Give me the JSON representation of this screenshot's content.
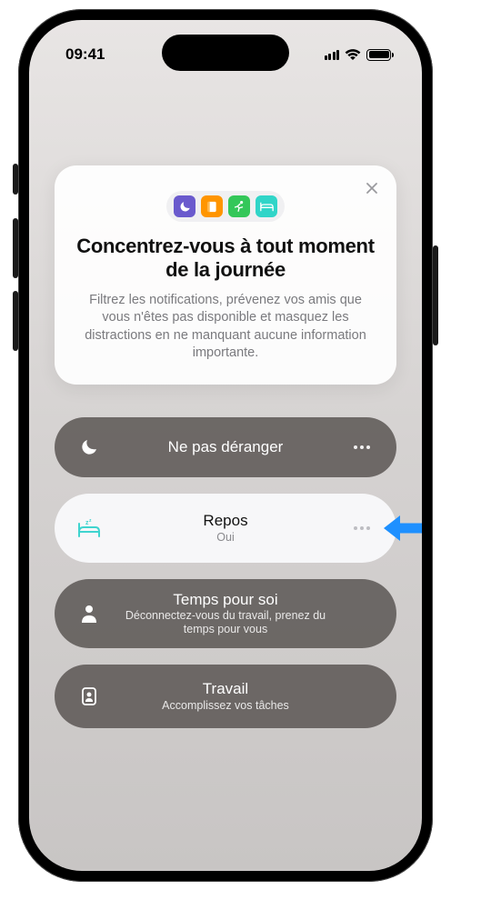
{
  "status": {
    "time": "09:41"
  },
  "intro": {
    "icons": [
      "moon-icon",
      "book-icon",
      "runner-icon",
      "bed-icon"
    ],
    "title": "Concentrez-vous à tout moment de la journée",
    "description": "Filtrez les notifications, prévenez vos amis que vous n'êtes pas disponible et masquez les distractions en ne manquant aucune information importante."
  },
  "focus_modes": {
    "dnd": {
      "label": "Ne pas déranger",
      "icon": "moon-icon"
    },
    "sleep": {
      "label": "Repos",
      "sub": "Oui",
      "icon": "bed-sleep-icon"
    },
    "personal": {
      "label": "Temps pour soi",
      "sub": "Déconnectez-vous du travail, prenez du temps pour vous",
      "icon": "person-icon"
    },
    "work": {
      "label": "Travail",
      "sub": "Accomplissez vos tâches",
      "icon": "badge-icon"
    }
  },
  "annotation": {
    "pointer": "pointer-arrow",
    "color": "#1e90ff"
  }
}
